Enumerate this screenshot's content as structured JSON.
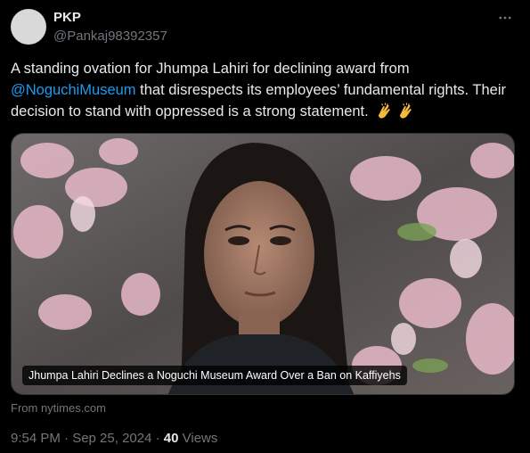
{
  "author": {
    "name": "PKP",
    "handle": "@Pankaj98392357"
  },
  "tweet": {
    "text_part1": "A standing ovation for Jhumpa Lahiri for declining award from",
    "mention": "@NoguchiMuseum",
    "text_part2": " that disrespects its employees’ fundamental rights. Their decision to stand with oppressed is a strong statement.",
    "emoji": "clapping-hands x2"
  },
  "link_card": {
    "caption": "Jhumpa Lahiri Declines a Noguchi Museum Award Over a Ban on Kaffiyehs",
    "source": "From nytimes.com"
  },
  "meta": {
    "timestamp": "9:54 PM · Sep 25, 2024 · ",
    "views_count": "40",
    "views_label": " Views"
  },
  "colors": {
    "background": "#000000",
    "text": "#e7e9ea",
    "secondary": "#71767b",
    "link": "#1d9bf0"
  },
  "icons": {
    "more": "more-options-icon",
    "clap": "clapping-hands-icon"
  }
}
